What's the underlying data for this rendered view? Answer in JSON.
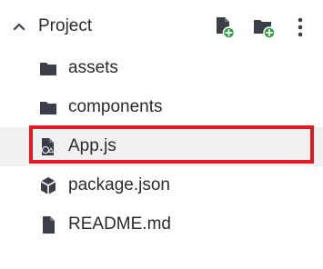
{
  "header": {
    "title": "Project",
    "collapse_icon": "chevron-up-icon",
    "new_file_icon": "new-file-icon",
    "new_folder_icon": "new-folder-icon",
    "more_icon": "more-vertical-icon"
  },
  "tree": {
    "items": [
      {
        "label": "assets",
        "icon": "folder-icon",
        "type": "folder"
      },
      {
        "label": "components",
        "icon": "folder-icon",
        "type": "folder"
      },
      {
        "label": "App.js",
        "icon": "js-file-icon",
        "type": "file",
        "selected": true
      },
      {
        "label": "package.json",
        "icon": "package-icon",
        "type": "file"
      },
      {
        "label": "README.md",
        "icon": "file-icon",
        "type": "file"
      }
    ]
  },
  "colors": {
    "text": "#2b2b2b",
    "icon": "#3a3f4b",
    "add_badge": "#2e9e3e",
    "selection_background": "#f0f0f0",
    "highlight_border": "#e01b24"
  }
}
